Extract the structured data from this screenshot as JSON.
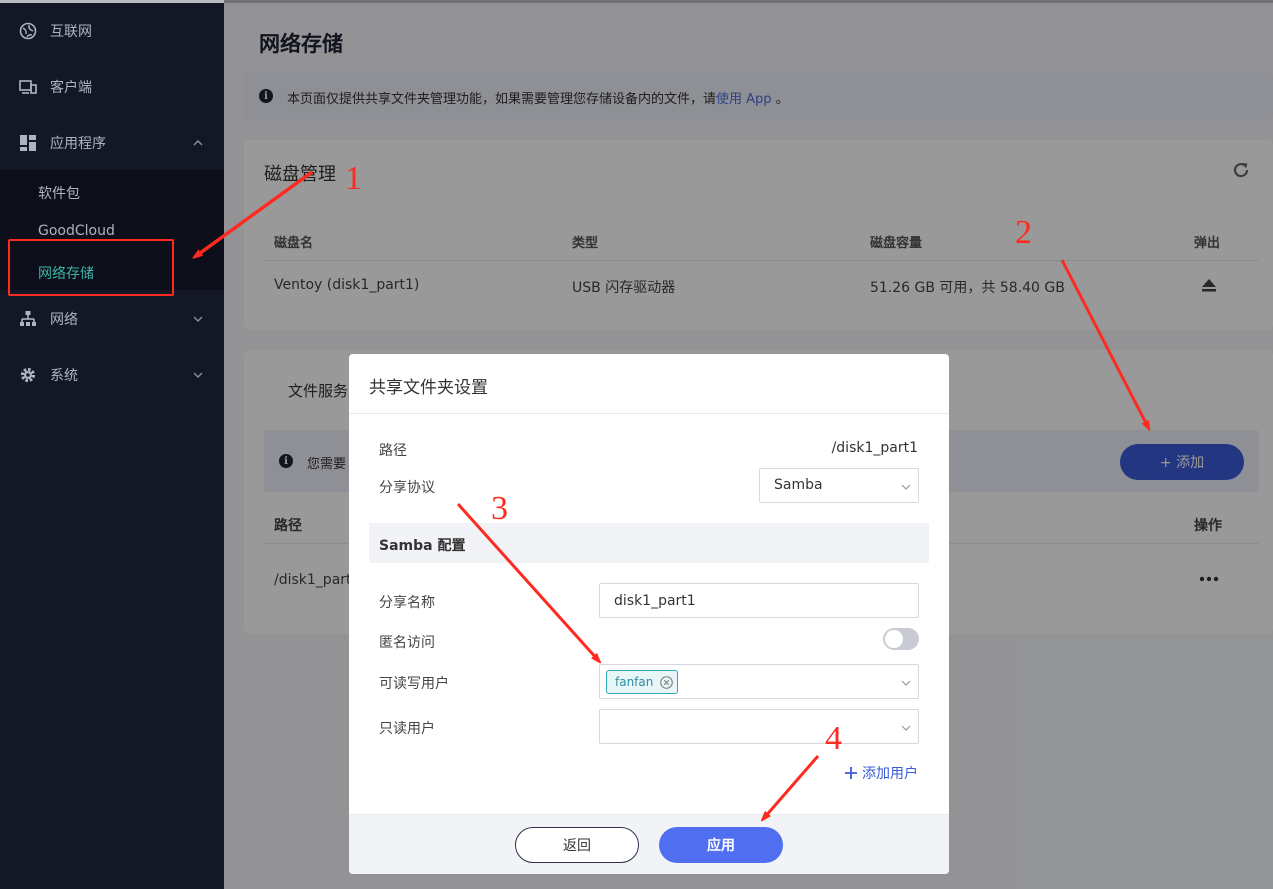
{
  "sidebar": {
    "items": [
      {
        "label": "互联网",
        "icon": "globe-icon"
      },
      {
        "label": "客户端",
        "icon": "devices-icon"
      },
      {
        "label": "应用程序",
        "icon": "apps-grid-icon"
      },
      {
        "label": "网络",
        "icon": "network-icon"
      },
      {
        "label": "系统",
        "icon": "gear-icon"
      }
    ],
    "sub_items": [
      {
        "label": "软件包"
      },
      {
        "label": "GoodCloud"
      },
      {
        "label": "网络存储",
        "active": true
      }
    ]
  },
  "main": {
    "page_title": "网络存储",
    "info_text": "本页面仅提供共享文件夹管理功能，如果需要管理您存储设备内的文件，请",
    "info_link": "使用 App",
    "info_tail": "。",
    "disk": {
      "title": "磁盘管理",
      "headers": [
        "磁盘名",
        "类型",
        "磁盘容量",
        "弹出"
      ],
      "row": {
        "name": "Ventoy (disk1_part1)",
        "type": "USB 闪存驱动器",
        "capacity": "51.26 GB 可用，共 58.40 GB"
      }
    },
    "service": {
      "tab": "文件服务",
      "banner_text": "您需要",
      "add_label": "+ 添加",
      "headers": [
        "路径",
        "操作"
      ],
      "row_path": "/disk1_part"
    }
  },
  "modal": {
    "title": "共享文件夹设置",
    "path_label": "路径",
    "path_value": "/disk1_part1",
    "protocol_label": "分享协议",
    "protocol_value": "Samba",
    "samba_header": "Samba 配置",
    "share_name_label": "分享名称",
    "share_name_value": "disk1_part1",
    "anonymous_label": "匿名访问",
    "anonymous_on": false,
    "rw_users_label": "可读写用户",
    "rw_user_tag": "fanfan",
    "ro_users_label": "只读用户",
    "add_user_label": "添加用户",
    "back_label": "返回",
    "apply_label": "应用"
  },
  "annotations": {
    "steps": [
      "1",
      "2",
      "3",
      "4"
    ],
    "color": "#ff2a1f"
  },
  "colors": {
    "sidebar_bg": "#141826",
    "accent": "#4f6ff0",
    "active_green": "#3fb3a8",
    "annotation_red": "#ff2a1f"
  }
}
